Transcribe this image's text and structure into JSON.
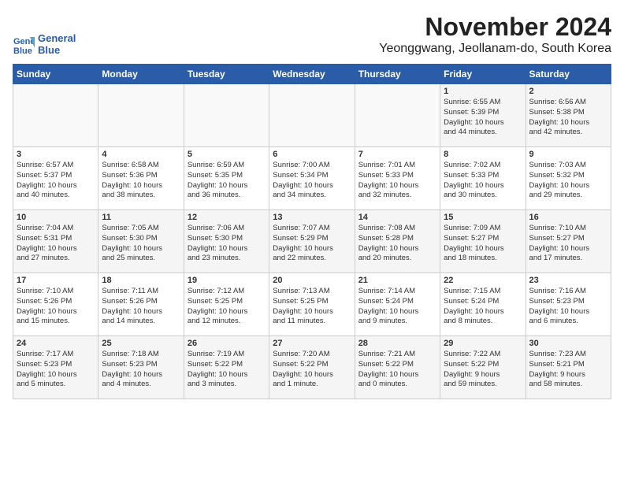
{
  "logo": {
    "line1": "General",
    "line2": "Blue"
  },
  "title": "November 2024",
  "location": "Yeonggwang, Jeollanam-do, South Korea",
  "headers": [
    "Sunday",
    "Monday",
    "Tuesday",
    "Wednesday",
    "Thursday",
    "Friday",
    "Saturday"
  ],
  "weeks": [
    [
      {
        "day": "",
        "info": ""
      },
      {
        "day": "",
        "info": ""
      },
      {
        "day": "",
        "info": ""
      },
      {
        "day": "",
        "info": ""
      },
      {
        "day": "",
        "info": ""
      },
      {
        "day": "1",
        "info": "Sunrise: 6:55 AM\nSunset: 5:39 PM\nDaylight: 10 hours\nand 44 minutes."
      },
      {
        "day": "2",
        "info": "Sunrise: 6:56 AM\nSunset: 5:38 PM\nDaylight: 10 hours\nand 42 minutes."
      }
    ],
    [
      {
        "day": "3",
        "info": "Sunrise: 6:57 AM\nSunset: 5:37 PM\nDaylight: 10 hours\nand 40 minutes."
      },
      {
        "day": "4",
        "info": "Sunrise: 6:58 AM\nSunset: 5:36 PM\nDaylight: 10 hours\nand 38 minutes."
      },
      {
        "day": "5",
        "info": "Sunrise: 6:59 AM\nSunset: 5:35 PM\nDaylight: 10 hours\nand 36 minutes."
      },
      {
        "day": "6",
        "info": "Sunrise: 7:00 AM\nSunset: 5:34 PM\nDaylight: 10 hours\nand 34 minutes."
      },
      {
        "day": "7",
        "info": "Sunrise: 7:01 AM\nSunset: 5:33 PM\nDaylight: 10 hours\nand 32 minutes."
      },
      {
        "day": "8",
        "info": "Sunrise: 7:02 AM\nSunset: 5:33 PM\nDaylight: 10 hours\nand 30 minutes."
      },
      {
        "day": "9",
        "info": "Sunrise: 7:03 AM\nSunset: 5:32 PM\nDaylight: 10 hours\nand 29 minutes."
      }
    ],
    [
      {
        "day": "10",
        "info": "Sunrise: 7:04 AM\nSunset: 5:31 PM\nDaylight: 10 hours\nand 27 minutes."
      },
      {
        "day": "11",
        "info": "Sunrise: 7:05 AM\nSunset: 5:30 PM\nDaylight: 10 hours\nand 25 minutes."
      },
      {
        "day": "12",
        "info": "Sunrise: 7:06 AM\nSunset: 5:30 PM\nDaylight: 10 hours\nand 23 minutes."
      },
      {
        "day": "13",
        "info": "Sunrise: 7:07 AM\nSunset: 5:29 PM\nDaylight: 10 hours\nand 22 minutes."
      },
      {
        "day": "14",
        "info": "Sunrise: 7:08 AM\nSunset: 5:28 PM\nDaylight: 10 hours\nand 20 minutes."
      },
      {
        "day": "15",
        "info": "Sunrise: 7:09 AM\nSunset: 5:27 PM\nDaylight: 10 hours\nand 18 minutes."
      },
      {
        "day": "16",
        "info": "Sunrise: 7:10 AM\nSunset: 5:27 PM\nDaylight: 10 hours\nand 17 minutes."
      }
    ],
    [
      {
        "day": "17",
        "info": "Sunrise: 7:10 AM\nSunset: 5:26 PM\nDaylight: 10 hours\nand 15 minutes."
      },
      {
        "day": "18",
        "info": "Sunrise: 7:11 AM\nSunset: 5:26 PM\nDaylight: 10 hours\nand 14 minutes."
      },
      {
        "day": "19",
        "info": "Sunrise: 7:12 AM\nSunset: 5:25 PM\nDaylight: 10 hours\nand 12 minutes."
      },
      {
        "day": "20",
        "info": "Sunrise: 7:13 AM\nSunset: 5:25 PM\nDaylight: 10 hours\nand 11 minutes."
      },
      {
        "day": "21",
        "info": "Sunrise: 7:14 AM\nSunset: 5:24 PM\nDaylight: 10 hours\nand 9 minutes."
      },
      {
        "day": "22",
        "info": "Sunrise: 7:15 AM\nSunset: 5:24 PM\nDaylight: 10 hours\nand 8 minutes."
      },
      {
        "day": "23",
        "info": "Sunrise: 7:16 AM\nSunset: 5:23 PM\nDaylight: 10 hours\nand 6 minutes."
      }
    ],
    [
      {
        "day": "24",
        "info": "Sunrise: 7:17 AM\nSunset: 5:23 PM\nDaylight: 10 hours\nand 5 minutes."
      },
      {
        "day": "25",
        "info": "Sunrise: 7:18 AM\nSunset: 5:23 PM\nDaylight: 10 hours\nand 4 minutes."
      },
      {
        "day": "26",
        "info": "Sunrise: 7:19 AM\nSunset: 5:22 PM\nDaylight: 10 hours\nand 3 minutes."
      },
      {
        "day": "27",
        "info": "Sunrise: 7:20 AM\nSunset: 5:22 PM\nDaylight: 10 hours\nand 1 minute."
      },
      {
        "day": "28",
        "info": "Sunrise: 7:21 AM\nSunset: 5:22 PM\nDaylight: 10 hours\nand 0 minutes."
      },
      {
        "day": "29",
        "info": "Sunrise: 7:22 AM\nSunset: 5:22 PM\nDaylight: 9 hours\nand 59 minutes."
      },
      {
        "day": "30",
        "info": "Sunrise: 7:23 AM\nSunset: 5:21 PM\nDaylight: 9 hours\nand 58 minutes."
      }
    ]
  ]
}
